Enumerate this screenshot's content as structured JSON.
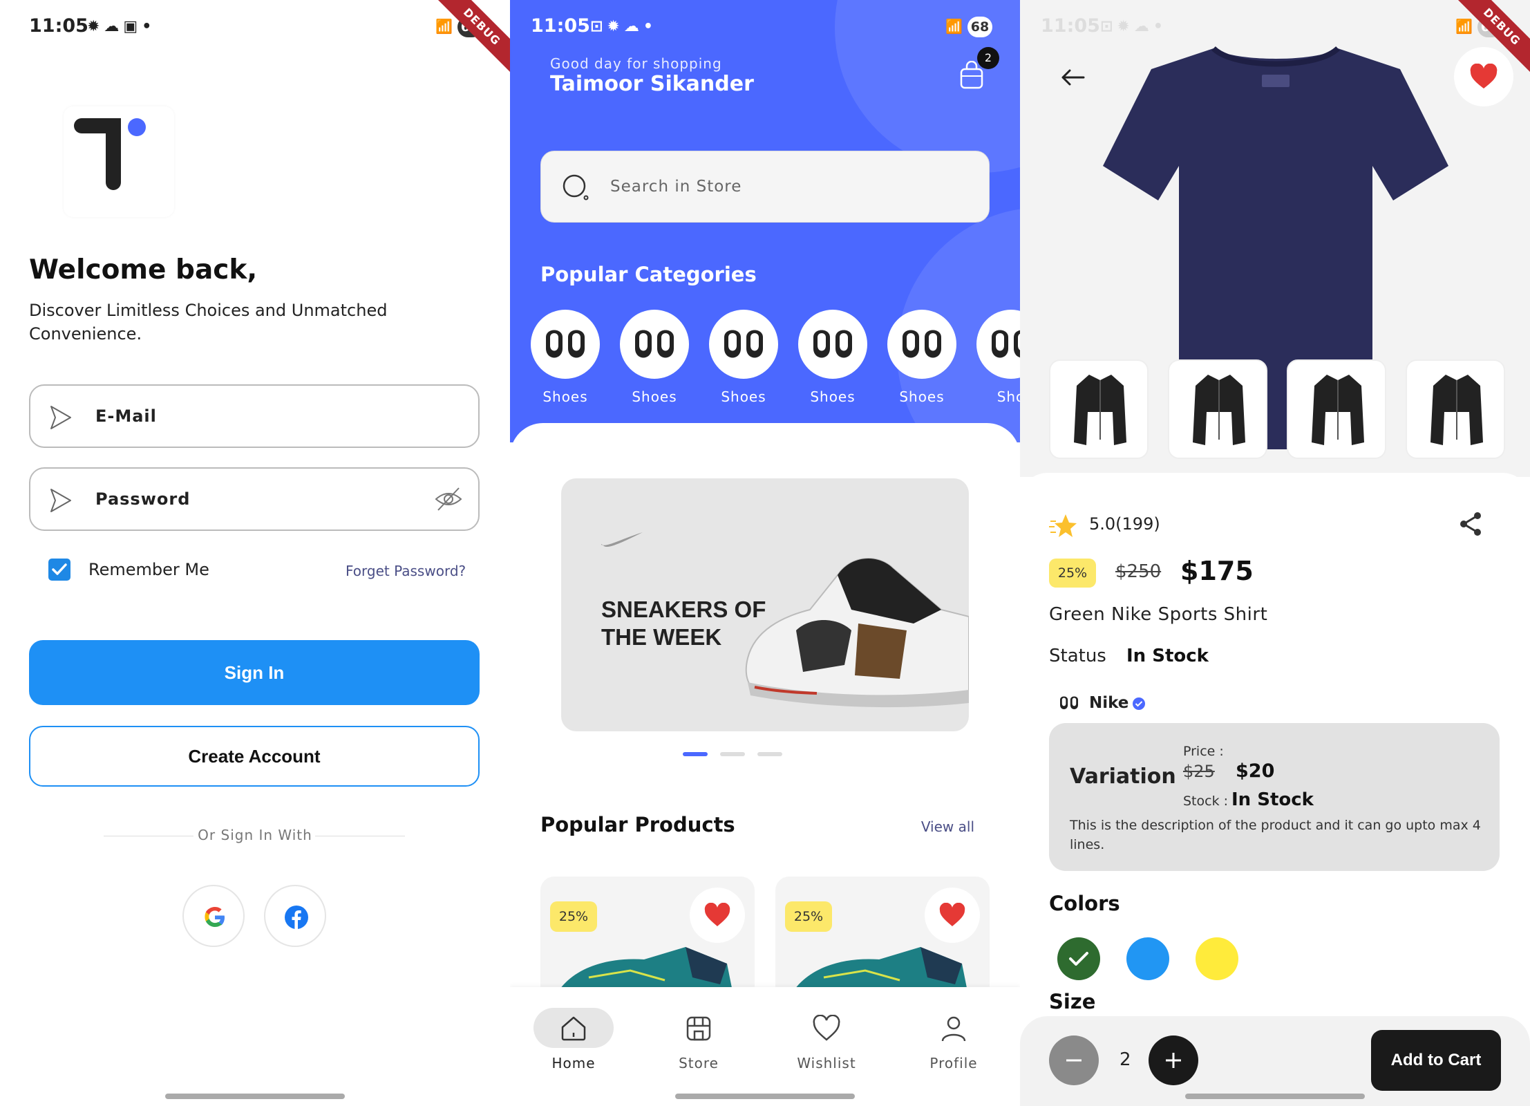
{
  "status_bar": {
    "time": "11:05",
    "battery": "68"
  },
  "debug_banner": "DEBUG",
  "login": {
    "welcome": "Welcome back,",
    "subtitle": "Discover Limitless Choices and Unmatched Convenience.",
    "email_label": "E-Mail",
    "password_label": "Password",
    "remember_me": "Remember Me",
    "remember_checked": true,
    "forget_password": "Forget Password?",
    "sign_in": "Sign In",
    "create_account": "Create Account",
    "or_sign_in_with": "Or Sign In With",
    "social": [
      "google-icon",
      "facebook-icon"
    ],
    "colors": {
      "primary": "#1e90f5",
      "check": "#1e88e5"
    }
  },
  "home": {
    "greeting": "Good day for shopping",
    "user_name": "Taimoor Sikander",
    "cart_count": "2",
    "search_placeholder": "Search in Store",
    "popular_categories": "Popular Categories",
    "categories": [
      {
        "label": "Shoes"
      },
      {
        "label": "Shoes"
      },
      {
        "label": "Shoes"
      },
      {
        "label": "Shoes"
      },
      {
        "label": "Shoes"
      },
      {
        "label": "Sho"
      }
    ],
    "banner_text_line1": "SNEAKERS OF",
    "banner_text_line2": "THE WEEK",
    "carousel": {
      "count": 3,
      "active": 0
    },
    "popular_products": "Popular Products",
    "view_all": "View all",
    "products": [
      {
        "discount": "25%",
        "favorite": true
      },
      {
        "discount": "25%",
        "favorite": true
      }
    ],
    "nav": [
      {
        "label": "Home",
        "icon": "home-icon",
        "active": true
      },
      {
        "label": "Store",
        "icon": "store-icon",
        "active": false
      },
      {
        "label": "Wishlist",
        "icon": "heart-icon",
        "active": false
      },
      {
        "label": "Profile",
        "icon": "user-icon",
        "active": false
      }
    ],
    "colors": {
      "hero": "#4b68ff"
    }
  },
  "product": {
    "rating": "5.0",
    "rating_count": "(199)",
    "discount": "25%",
    "old_price": "$250",
    "price": "$175",
    "title": "Green Nike Sports Shirt",
    "status_label": "Status",
    "status_value": "In Stock",
    "brand": "Nike",
    "variation": {
      "title": "Variation",
      "price_label": "Price :",
      "old_price": "$25",
      "price": "$20",
      "stock_label": "Stock :",
      "stock_value": "In Stock",
      "description": "This is the description of the product and it can go upto max 4 lines."
    },
    "colors_title": "Colors",
    "swatches": [
      {
        "name": "green",
        "hex": "#2e6b2f",
        "selected": true
      },
      {
        "name": "blue",
        "hex": "#2196f3",
        "selected": false
      },
      {
        "name": "yellow",
        "hex": "#ffeb3b",
        "selected": false
      }
    ],
    "size_title": "Size",
    "quantity": "2",
    "add_to_cart": "Add to Cart"
  }
}
